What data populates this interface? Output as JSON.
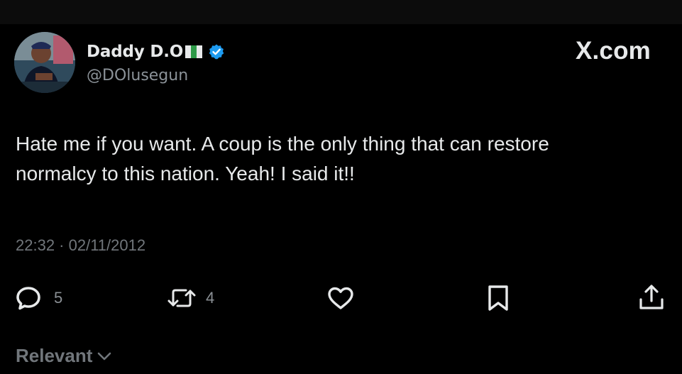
{
  "author": {
    "display_name": "Daddy D.O",
    "handle": "@DOlusegun",
    "flag_icon": "nigeria-flag-icon",
    "verified_icon": "verified-badge-icon",
    "verified_color": "#1d9bf0"
  },
  "brand": {
    "label": "X.com"
  },
  "tweet": {
    "lines": [
      "Hate me if you want. A coup is the only thing that can restore",
      "normalcy to this nation. Yeah! I said it!!"
    ],
    "timestamp": "22:32 · 02/11/2012"
  },
  "actions": {
    "reply": {
      "icon": "reply-icon",
      "count": "5"
    },
    "repost": {
      "icon": "repost-icon",
      "count": "4"
    },
    "like": {
      "icon": "heart-icon"
    },
    "bookmark": {
      "icon": "bookmark-icon"
    },
    "share": {
      "icon": "share-icon"
    }
  },
  "sort": {
    "label": "Relevant",
    "icon": "chevron-down-icon"
  },
  "colors": {
    "background": "#000000",
    "text": "#e7e9ea",
    "muted": "#71767b"
  }
}
